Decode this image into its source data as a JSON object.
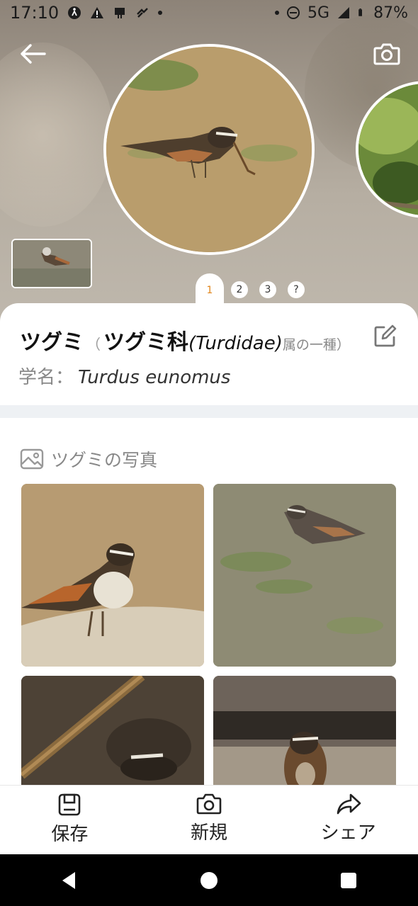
{
  "status_bar": {
    "time": "17:10",
    "network": "5G",
    "battery": "87%"
  },
  "hero": {
    "pager": [
      "1",
      "2",
      "3",
      "?"
    ],
    "active_page": "1"
  },
  "species": {
    "name": "ツグミ",
    "paren_open": "（",
    "family_jp": "ツグミ科",
    "family_latin": "(Turdidae)",
    "genus_note": "属の一種",
    "paren_close": "）",
    "sci_label": "学名：",
    "sci_name": "Turdus eunomus"
  },
  "photos_section": {
    "title": "ツグミの写真"
  },
  "toolbar": {
    "save_label": "保存",
    "new_label": "新規",
    "share_label": "シェア"
  },
  "colors": {
    "accent": "#e0861c",
    "divider": "#eef1f4"
  }
}
